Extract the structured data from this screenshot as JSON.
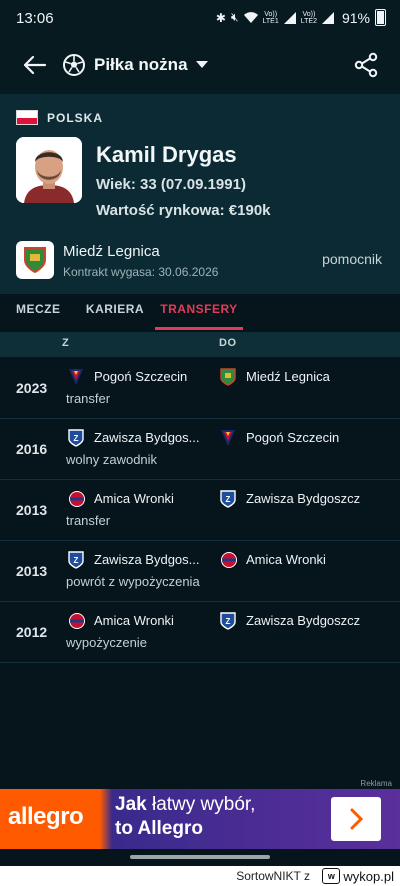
{
  "status_bar": {
    "time": "13:06",
    "signal_1_label": [
      "Vo))",
      "LTE1"
    ],
    "signal_2_label": [
      "Vo))",
      "LTE2"
    ],
    "battery": "91%"
  },
  "topbar": {
    "sport": "Piłka nożna"
  },
  "player": {
    "country": "POLSKA",
    "name": "Kamil Drygas",
    "age": "Wiek: 33 (07.09.1991)",
    "market_value": "Wartość rynkowa: €190k",
    "club": "Miedź Legnica",
    "contract": "Kontrakt wygasa: 30.06.2026",
    "position": "pomocnik"
  },
  "tabs": [
    "MECZE",
    "KARIERA",
    "TRANSFERY"
  ],
  "active_tab": "TRANSFERY",
  "table": {
    "header_from": "Z",
    "header_to": "DO",
    "rows": [
      {
        "year": "2023",
        "from": "Pogoń Szczecin",
        "to": "Miedź Legnica",
        "type": "transfer"
      },
      {
        "year": "2016",
        "from": "Zawisza Bydgos...",
        "to": "Pogoń Szczecin",
        "type": "wolny zawodnik"
      },
      {
        "year": "2013",
        "from": "Amica Wronki",
        "to": "Zawisza Bydgoszcz",
        "type": "transfer"
      },
      {
        "year": "2013",
        "from": "Zawisza Bydgos...",
        "to": "Amica Wronki",
        "type": "powrót z wypożyczenia"
      },
      {
        "year": "2012",
        "from": "Amica Wronki",
        "to": "Zawisza Bydgoszcz",
        "type": "wypożyczenie"
      }
    ]
  },
  "ad": {
    "label": "Reklama",
    "logo": "allegro",
    "line1_bold": "Jak",
    "line1_rest": " łatwy wybór,",
    "line2": "to Allegro"
  },
  "watermark": {
    "user": "SortowNIKT z",
    "badge": "w",
    "site": "wykop.pl"
  },
  "colors": {
    "accent": "#e23c5a",
    "background": "#06141b",
    "header": "#0b2a33",
    "ad_brand": "#ff5a00"
  }
}
